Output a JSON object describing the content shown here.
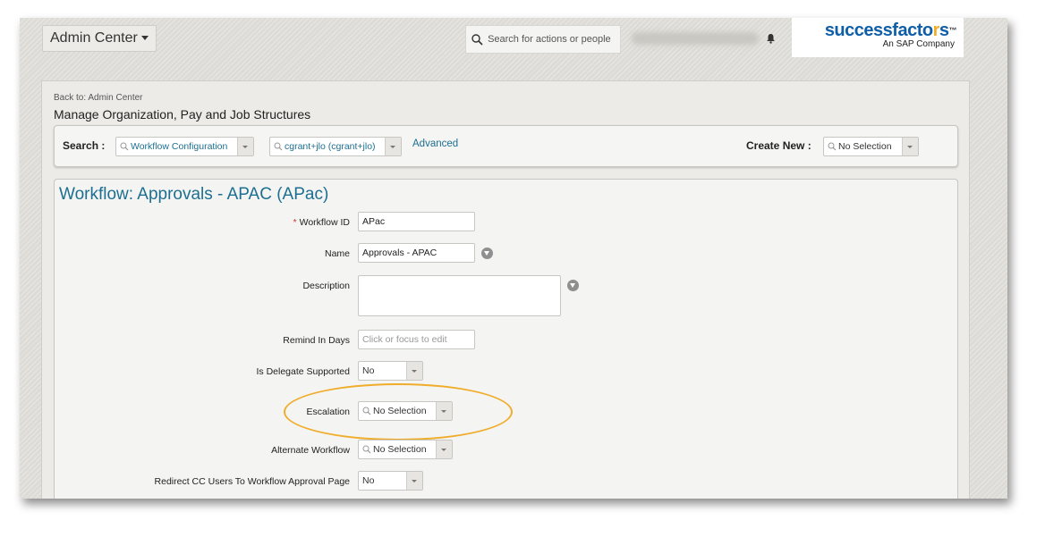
{
  "header": {
    "admin_center_label": "Admin Center",
    "search_placeholder": "Search for actions or people",
    "logo_text": "successfactors",
    "logo_tagline": "An SAP Company"
  },
  "page": {
    "back_to": "Back to: Admin Center",
    "title": "Manage Organization, Pay and Job Structures"
  },
  "search_bar": {
    "search_label": "Search :",
    "type_value": "Workflow Configuration",
    "item_value": "cgrant+jlo (cgrant+jlo)",
    "advanced_label": "Advanced",
    "create_new_label": "Create New :",
    "create_new_value": "No Selection"
  },
  "form": {
    "title": "Workflow: Approvals - APAC (APac)",
    "fields": {
      "workflow_id": {
        "label": "Workflow ID",
        "required_mark": "*",
        "value": "APac"
      },
      "name": {
        "label": "Name",
        "value": "Approvals - APAC"
      },
      "description": {
        "label": "Description",
        "value": ""
      },
      "remind_in_days": {
        "label": "Remind In Days",
        "placeholder": "Click or focus to edit"
      },
      "is_delegate_supported": {
        "label": "Is Delegate Supported",
        "value": "No"
      },
      "escalation": {
        "label": "Escalation",
        "value": "No Selection"
      },
      "alternate_workflow": {
        "label": "Alternate Workflow",
        "value": "No Selection"
      },
      "redirect_cc_users": {
        "label": "Redirect CC Users To Workflow Approval Page",
        "value": "No"
      }
    }
  },
  "colors": {
    "brand_blue": "#0f5ea8",
    "brand_accent": "#f0ad2b",
    "link_teal": "#1d6f92",
    "highlight_ellipse": "#f0ad2b",
    "required_star": "#d0342c"
  }
}
